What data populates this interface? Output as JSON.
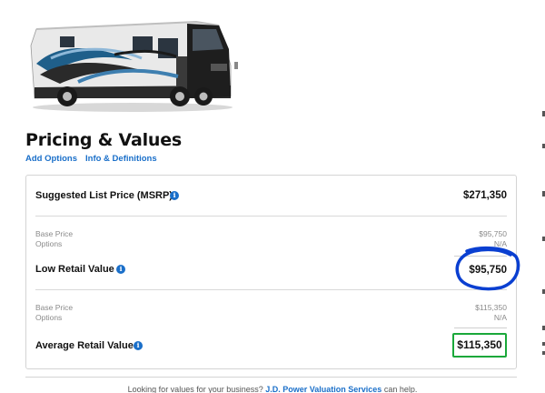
{
  "page": {
    "title": "Pricing & Values"
  },
  "links": {
    "add_options": "Add Options",
    "info_definitions": "Info & Definitions"
  },
  "msrp": {
    "label": "Suggested List Price (MSRP)",
    "value": "$271,350"
  },
  "low_retail": {
    "base_price_label": "Base Price",
    "base_price_value": "$95,750",
    "options_label": "Options",
    "options_value": "N/A",
    "label": "Low Retail Value",
    "value": "$95,750"
  },
  "average_retail": {
    "base_price_label": "Base Price",
    "base_price_value": "$115,350",
    "options_label": "Options",
    "options_value": "N/A",
    "label": "Average Retail Value",
    "value": "$115,350"
  },
  "footer": {
    "text_before": "Looking for values for your business? ",
    "link": "J.D. Power Valuation Services",
    "text_after": " can help."
  },
  "icons": {
    "info": "info-icon"
  },
  "colors": {
    "link_blue": "#1a6fc9",
    "highlight_green": "#1aa83a",
    "annotation_blue": "#0a3fd1"
  }
}
